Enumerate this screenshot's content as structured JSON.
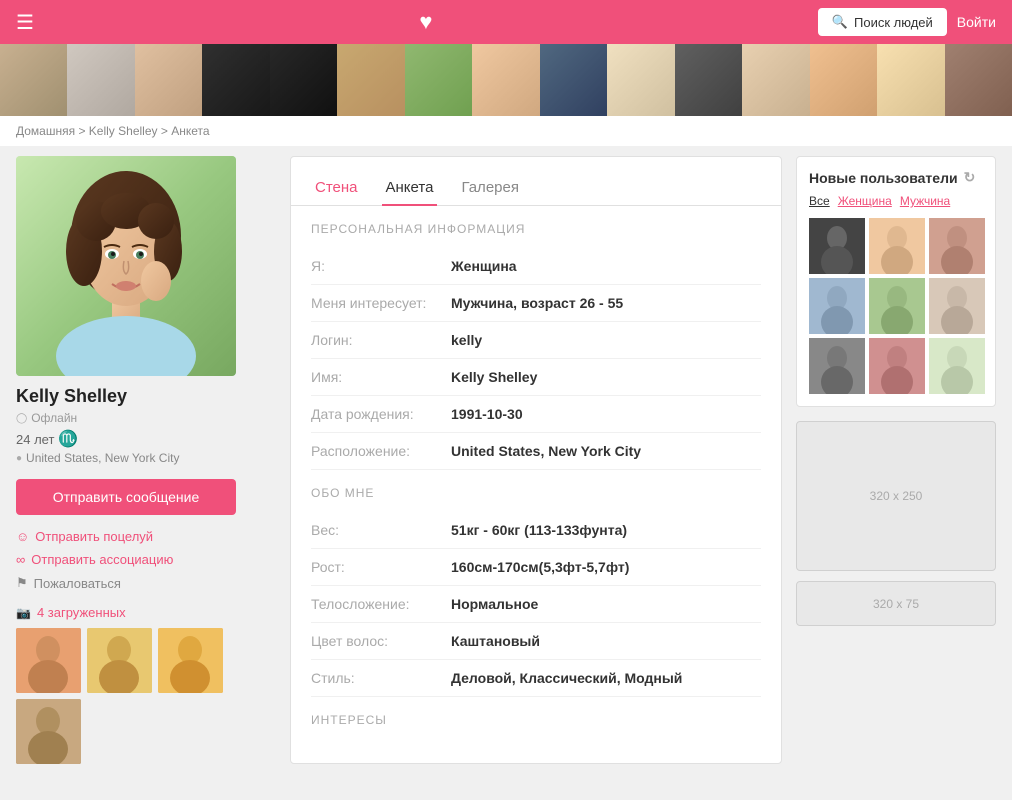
{
  "header": {
    "search_label": "Поиск людей",
    "login_label": "Войти",
    "heart_symbol": "♥"
  },
  "breadcrumb": {
    "home": "Домашняя",
    "sep1": " > ",
    "name": "Kelly Shelley",
    "sep2": " > ",
    "page": "Анкета"
  },
  "profile": {
    "name": "Kelly Shelley",
    "status": "Офлайн",
    "age": "24 лет",
    "zodiac": "♏",
    "location": "United States, New York City",
    "send_msg": "Отправить сообщение",
    "action1": "Отправить поцелуй",
    "action2": "Отправить ассоциацию",
    "action3": "Пожаловаться",
    "photo_count": "4 загруженных"
  },
  "tabs": {
    "wall": "Стена",
    "anketa": "Анкета",
    "gallery": "Галерея"
  },
  "personal_info": {
    "section_title": "ПЕРСОНАЛЬНАЯ ИНФОРМАЦИЯ",
    "gender_label": "Я:",
    "gender_value": "Женщина",
    "interested_label": "Меня интересует:",
    "interested_value": "Мужчина, возраст 26 - 55",
    "login_label": "Логин:",
    "login_value": "kelly",
    "name_label": "Имя:",
    "name_value": "Kelly Shelley",
    "dob_label": "Дата рождения:",
    "dob_value": "1991-10-30",
    "location_label": "Расположение:",
    "location_value": "United States, New York City"
  },
  "about_me": {
    "section_title": "ОБО МНЕ",
    "weight_label": "Вес:",
    "weight_value": "51кг - 60кг (113-133фунта)",
    "height_label": "Рост:",
    "height_value": "160см-170см(5,3фт-5,7фт)",
    "build_label": "Телосложение:",
    "build_value": "Нормальное",
    "hair_label": "Цвет волос:",
    "hair_value": "Каштановый",
    "style_label": "Стиль:",
    "style_value": "Деловой, Классический, Модный"
  },
  "interests": {
    "section_title": "ИНТЕРЕСЫ"
  },
  "new_users": {
    "title": "Новые пользователи",
    "filter_all": "Все",
    "filter_female": "Женщина",
    "filter_male": "Мужчина"
  },
  "ads": {
    "ad1": "320 x 250",
    "ad2": "320 x 75"
  }
}
